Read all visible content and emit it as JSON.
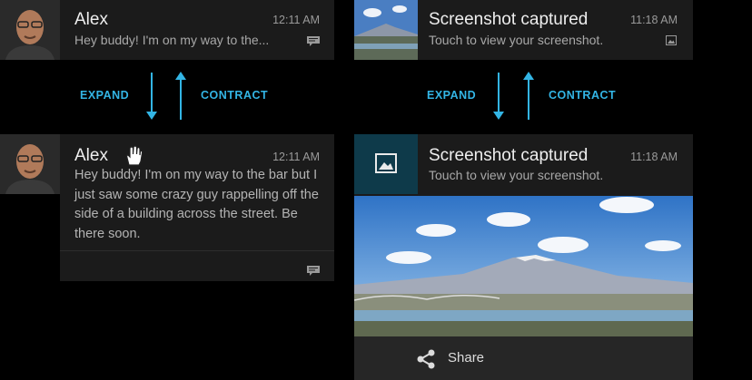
{
  "left": {
    "collapsed": {
      "sender": "Alex",
      "time": "12:11 AM",
      "preview": "Hey buddy! I'm on my way to the..."
    },
    "expand_label": "EXPAND",
    "contract_label": "CONTRACT",
    "expanded": {
      "sender": "Alex",
      "time": "12:11 AM",
      "body": "Hey buddy! I'm on my way to the bar but I just saw some crazy guy rappelling off the side of a building across the street. Be there soon."
    }
  },
  "right": {
    "collapsed": {
      "title": "Screenshot captured",
      "time": "11:18 AM",
      "subtitle": "Touch to view your screenshot."
    },
    "expand_label": "EXPAND",
    "contract_label": "CONTRACT",
    "expanded": {
      "title": "Screenshot captured",
      "time": "11:18 AM",
      "subtitle": "Touch to view your screenshot.",
      "share_label": "Share"
    }
  },
  "icons": {
    "message": "message-icon",
    "image": "image-icon",
    "share": "share-icon",
    "hand": "hand-cursor-icon"
  },
  "colors": {
    "accent": "#33b5e5",
    "card": "#1b1b1b",
    "background": "#000000"
  }
}
